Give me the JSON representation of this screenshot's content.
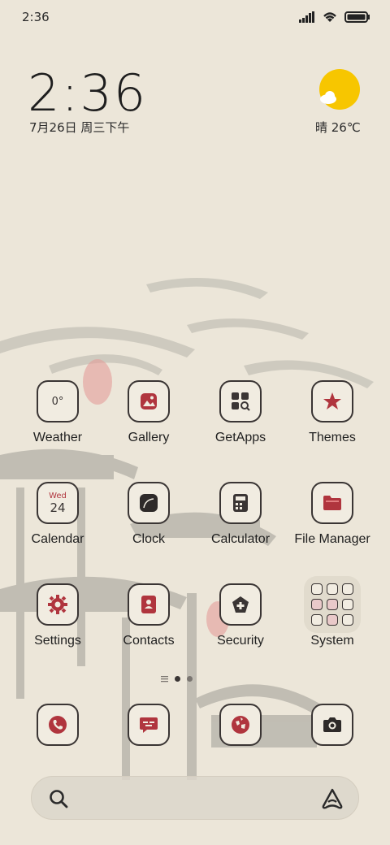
{
  "status_bar": {
    "time": "2:36"
  },
  "widget": {
    "clock": "2:36",
    "date": "7月26日 周三下午",
    "weather": "晴 26℃"
  },
  "apps": [
    {
      "label": "Weather",
      "icon": "weather-icon",
      "text": "0°"
    },
    {
      "label": "Gallery",
      "icon": "gallery-icon"
    },
    {
      "label": "GetApps",
      "icon": "getapps-icon"
    },
    {
      "label": "Themes",
      "icon": "themes-icon"
    },
    {
      "label": "Calendar",
      "icon": "calendar-icon",
      "day": "Wed",
      "date": "24"
    },
    {
      "label": "Clock",
      "icon": "clock-icon"
    },
    {
      "label": "Calculator",
      "icon": "calculator-icon"
    },
    {
      "label": "File Manager",
      "icon": "file-manager-icon"
    },
    {
      "label": "Settings",
      "icon": "settings-icon"
    },
    {
      "label": "Contacts",
      "icon": "contacts-icon"
    },
    {
      "label": "Security",
      "icon": "security-icon"
    },
    {
      "label": "System",
      "icon": "system-folder-icon"
    }
  ],
  "dock": [
    {
      "icon": "phone-icon"
    },
    {
      "icon": "messages-icon"
    },
    {
      "icon": "browser-icon"
    },
    {
      "icon": "camera-icon"
    }
  ],
  "page_indicator": {
    "pages": 2,
    "active": 1
  },
  "search": {
    "placeholder": ""
  },
  "colors": {
    "accent": "#b0353e",
    "outline": "#3a3534",
    "background": "#ece6d9",
    "sun": "#f7c600"
  }
}
